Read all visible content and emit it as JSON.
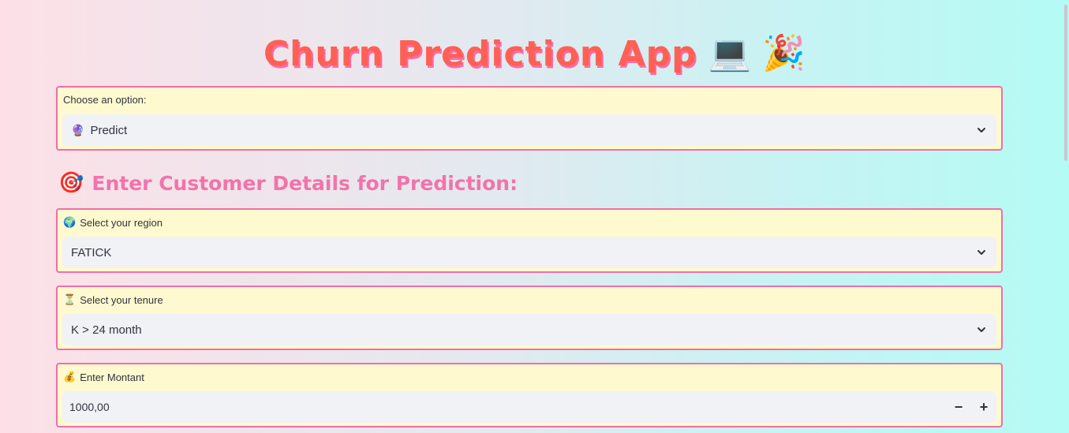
{
  "app": {
    "title": "Churn Prediction App",
    "title_icons": [
      "💻",
      "🎉"
    ]
  },
  "mode_select": {
    "label": "Choose an option:",
    "value_icon": "🔮",
    "value": "Predict"
  },
  "section": {
    "icon": "🎯",
    "heading": "Enter Customer Details for Prediction:"
  },
  "region": {
    "icon": "🌍",
    "label": "Select your region",
    "value": "FATICK"
  },
  "tenure": {
    "icon": "⏳",
    "label": "Select your tenure",
    "value": "K > 24 month"
  },
  "montant": {
    "icon": "💰",
    "label": "Enter Montant",
    "value": "1000,00",
    "decrement_label": "−",
    "increment_label": "+"
  },
  "colors": {
    "title": "#ff6056",
    "heading": "#f273aa",
    "card_border": "#f06fa8",
    "card_bg": "#fff9cf",
    "field_bg": "#f0f2f6"
  }
}
